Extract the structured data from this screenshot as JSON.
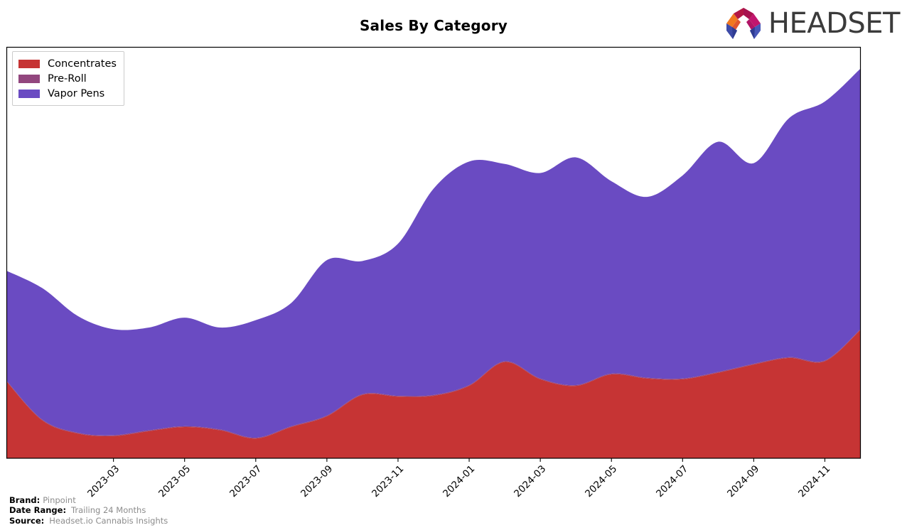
{
  "header": {
    "title": "Sales By Category",
    "logo": {
      "text": "HEADSET",
      "mark_name": "headset-arch-logo",
      "colors": [
        "#F07820",
        "#D0263C",
        "#A8134F",
        "#C2166E",
        "#3E4BA8",
        "#4857B8"
      ]
    }
  },
  "legend": {
    "position": "upper-left",
    "items": [
      {
        "label": "Concentrates",
        "color": "#C63434"
      },
      {
        "label": "Pre-Roll",
        "color": "#92467E"
      },
      {
        "label": "Vapor Pens",
        "color": "#6A4BC2"
      }
    ]
  },
  "footer": {
    "rows": [
      {
        "key": "Brand:",
        "value": "Pinpoint"
      },
      {
        "key": "Date Range:",
        "value": "Trailing 24 Months"
      },
      {
        "key": "Source:",
        "value": "Headset.io Cannabis Insights"
      }
    ]
  },
  "chart_data": {
    "type": "area",
    "stacked": true,
    "title": "Sales By Category",
    "xlabel": "",
    "ylabel": "",
    "grid": false,
    "legend_position": "upper left",
    "axis": {
      "x_tick_labels": [
        "2023-03",
        "2023-05",
        "2023-07",
        "2023-09",
        "2023-11",
        "2024-01",
        "2024-03",
        "2024-05",
        "2024-07",
        "2024-09",
        "2024-11"
      ],
      "x_tick_months": [
        "2023-03",
        "2023-05",
        "2023-07",
        "2023-09",
        "2023-11",
        "2024-01",
        "2024-03",
        "2024-05",
        "2024-07",
        "2024-09",
        "2024-11"
      ],
      "y_tick_labels": [],
      "ylim": [
        0,
        100
      ]
    },
    "x": [
      "2022-12",
      "2023-01",
      "2023-02",
      "2023-03",
      "2023-04",
      "2023-05",
      "2023-06",
      "2023-07",
      "2023-08",
      "2023-09",
      "2023-10",
      "2023-11",
      "2023-12",
      "2024-01",
      "2024-02",
      "2024-03",
      "2024-04",
      "2024-05",
      "2024-06",
      "2024-07",
      "2024-08",
      "2024-09",
      "2024-10",
      "2024-11"
    ],
    "series": [
      {
        "name": "Concentrates",
        "color": "#C63434",
        "values": [
          18.6,
          9.2,
          6.0,
          5.4,
          6.6,
          7.6,
          6.8,
          4.8,
          7.6,
          10.2,
          15.4,
          15.0,
          15.2,
          17.6,
          23.4,
          19.2,
          17.6,
          20.4,
          19.4,
          19.2,
          20.8,
          22.8,
          24.4,
          23.6,
          31.2
        ]
      },
      {
        "name": "Pre-Roll",
        "color": "#92467E",
        "values": [
          0.2,
          0.2,
          0.2,
          0.2,
          0.2,
          0.2,
          0.2,
          0.2,
          0.2,
          0.2,
          0.2,
          0.2,
          0.2,
          0.2,
          0.2,
          0.2,
          0.2,
          0.2,
          0.2,
          0.2,
          0.2,
          0.2,
          0.2,
          0.2,
          0.2
        ]
      },
      {
        "name": "Vapor Pens",
        "color": "#6A4BC2",
        "values": [
          26.8,
          32.0,
          28.4,
          25.8,
          25.0,
          26.4,
          24.8,
          28.6,
          30.0,
          37.8,
          32.4,
          37.0,
          50.2,
          54.4,
          48.0,
          50.0,
          55.4,
          46.8,
          44.0,
          49.4,
          56.0,
          48.8,
          58.2,
          63.0,
          63.4
        ]
      }
    ],
    "note": "Stacked smoothed area (streamgraph-style spline). Pre-Roll is near-zero throughout and renders as a hairline boundary."
  }
}
